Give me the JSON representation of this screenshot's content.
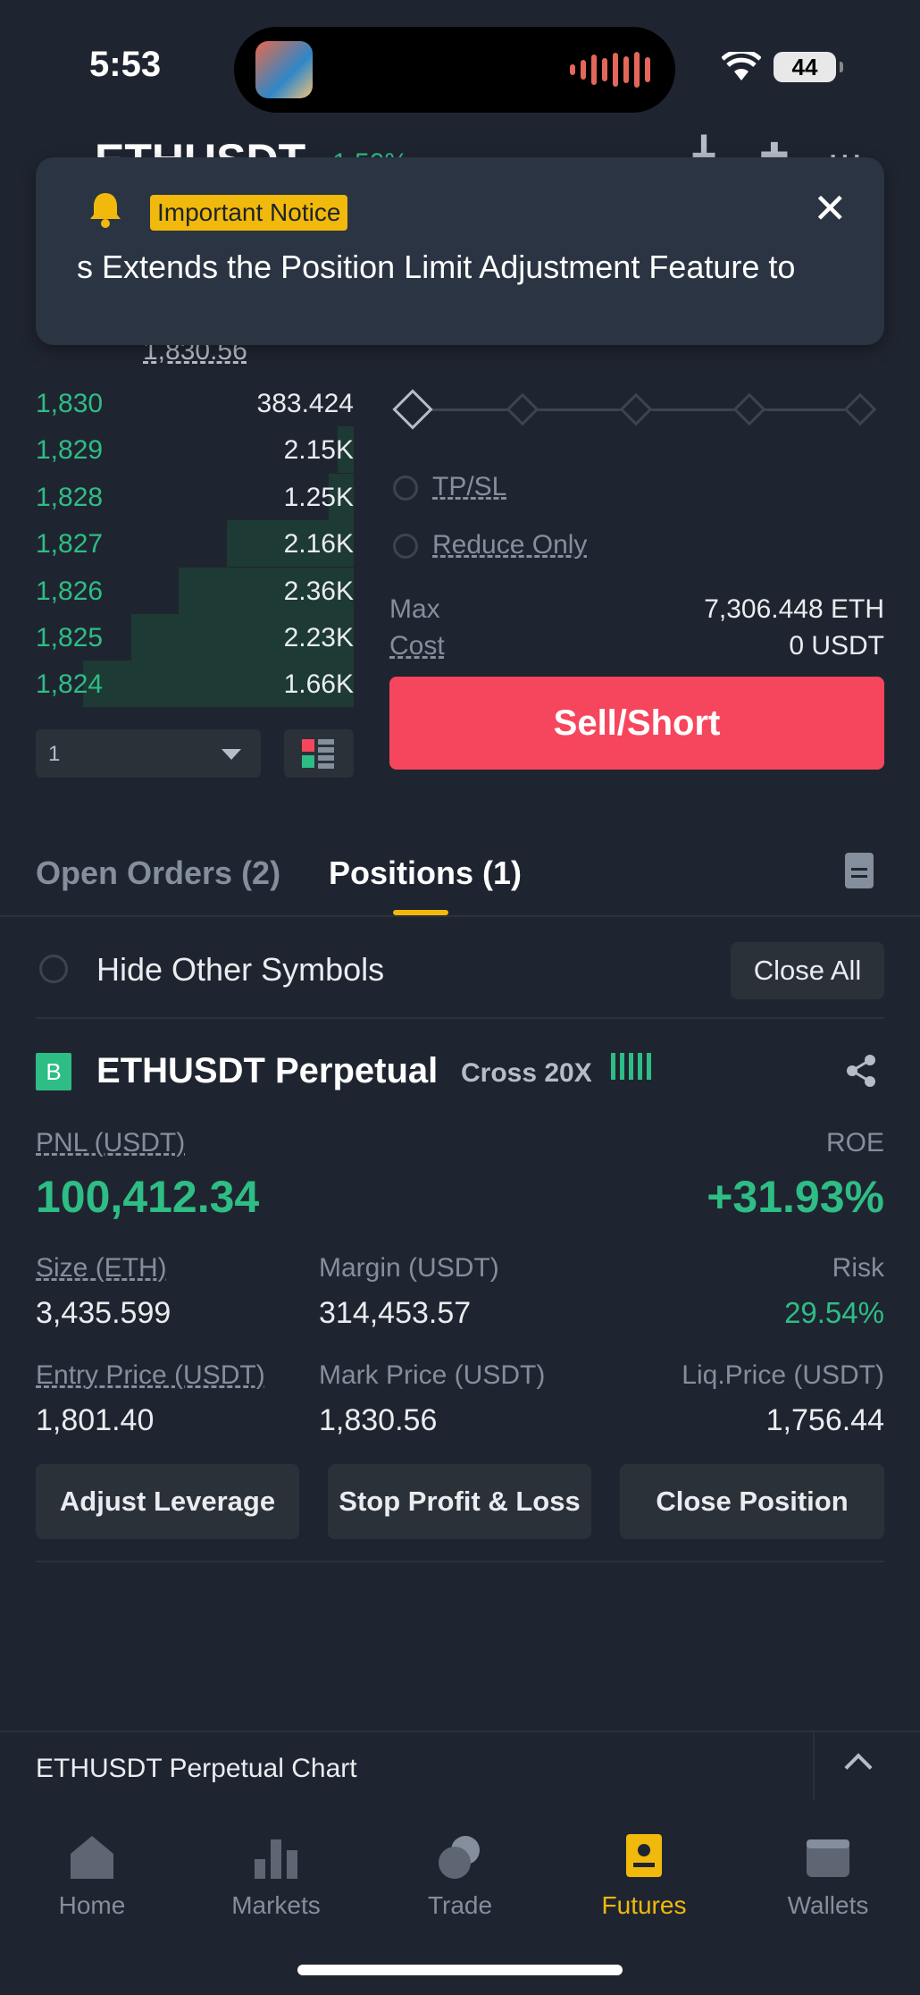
{
  "status_bar": {
    "time": "5:53",
    "battery": "44"
  },
  "header": {
    "symbol": "ETHUSDT",
    "change": "1.50%"
  },
  "notice": {
    "badge": "Important Notice",
    "text": "s Extends the Position Limit Adjustment Feature to"
  },
  "order_book": {
    "last_price": "1,830.56",
    "rows": [
      {
        "price": "1,830",
        "qty": "383.424",
        "depth": 0.0
      },
      {
        "price": "1,829",
        "qty": "2.15K",
        "depth": 0.05
      },
      {
        "price": "1,828",
        "qty": "1.25K",
        "depth": 0.08
      },
      {
        "price": "1,827",
        "qty": "2.16K",
        "depth": 0.4
      },
      {
        "price": "1,826",
        "qty": "2.36K",
        "depth": 0.55
      },
      {
        "price": "1,825",
        "qty": "2.23K",
        "depth": 0.7
      },
      {
        "price": "1,824",
        "qty": "1.66K",
        "depth": 0.85
      }
    ],
    "depth_precision": "1"
  },
  "order_form": {
    "tpsl_label": "TP/SL",
    "reduce_only_label": "Reduce Only",
    "max_label": "Max",
    "max_value": "7,306.448 ETH",
    "cost_label": "Cost",
    "cost_value": "0 USDT",
    "sell_label": "Sell/Short"
  },
  "tabs": {
    "open_orders": "Open Orders (2)",
    "positions": "Positions (1)"
  },
  "filter": {
    "hide_label": "Hide Other Symbols",
    "close_all": "Close All"
  },
  "position": {
    "badge": "B",
    "title": "ETHUSDT Perpetual",
    "mode": "Cross 20X",
    "pnl_label": "PNL (USDT)",
    "pnl_value": "100,412.34",
    "roe_label": "ROE",
    "roe_value": "+31.93%",
    "size_label": "Size (ETH)",
    "size_value": "3,435.599",
    "margin_label": "Margin (USDT)",
    "margin_value": "314,453.57",
    "risk_label": "Risk",
    "risk_value": "29.54%",
    "entry_label": "Entry Price (USDT)",
    "entry_value": "1,801.40",
    "mark_label": "Mark Price (USDT)",
    "mark_value": "1,830.56",
    "liq_label": "Liq.Price (USDT)",
    "liq_value": "1,756.44",
    "adjust_leverage": "Adjust Leverage",
    "stop_profit_loss": "Stop Profit & Loss",
    "close_position": "Close Position"
  },
  "chart_bar": {
    "label": "ETHUSDT Perpetual  Chart"
  },
  "bottom_nav": {
    "home": "Home",
    "markets": "Markets",
    "trade": "Trade",
    "futures": "Futures",
    "wallets": "Wallets"
  },
  "colors": {
    "background": "#1f2530",
    "buy_green": "#2ebd85",
    "sell_red": "#f6465d",
    "accent_yellow": "#f0b90b"
  }
}
